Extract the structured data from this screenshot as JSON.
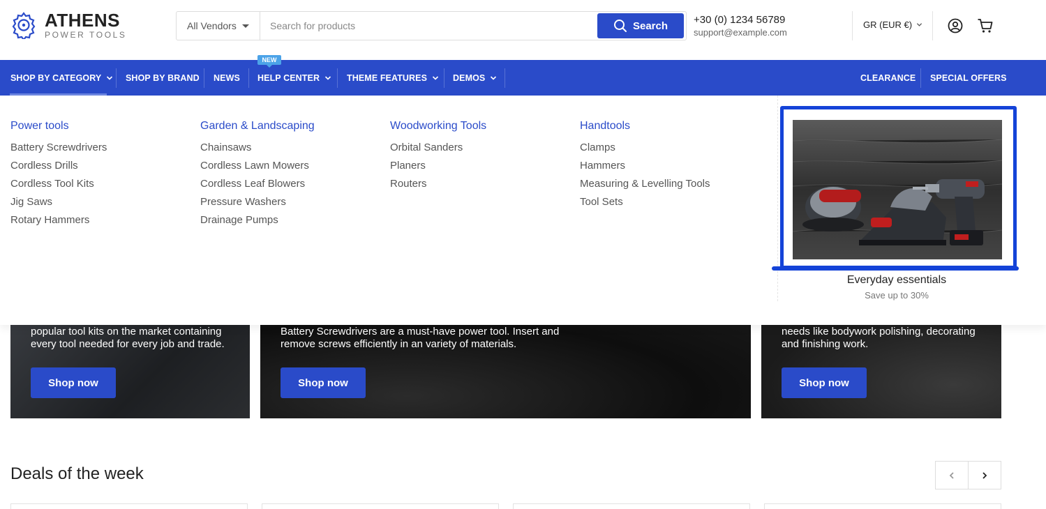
{
  "brand": {
    "name": "ATHENS",
    "tagline": "POWER TOOLS",
    "accent": "#2a4bc9"
  },
  "search": {
    "vendor_label": "All Vendors",
    "placeholder": "Search for products",
    "button_label": "Search"
  },
  "contact": {
    "phone": "+30 (0) 1234 56789",
    "email": "support@example.com"
  },
  "currency": {
    "label": "GR (EUR €)"
  },
  "header_icons": [
    "account-icon",
    "cart-icon"
  ],
  "nav": {
    "left": [
      {
        "label": "SHOP BY CATEGORY",
        "dropdown": true,
        "active": true
      },
      {
        "label": "SHOP BY BRAND",
        "dropdown": false
      },
      {
        "label": "NEWS",
        "dropdown": false
      },
      {
        "label": "HELP CENTER",
        "dropdown": true,
        "badge": "NEW"
      },
      {
        "label": "THEME FEATURES",
        "dropdown": true
      },
      {
        "label": "DEMOS",
        "dropdown": true
      }
    ],
    "right": [
      {
        "label": "CLEARANCE"
      },
      {
        "label": "SPECIAL OFFERS"
      }
    ]
  },
  "mega_menu": {
    "columns": [
      {
        "title": "Power tools",
        "items": [
          "Battery Screwdrivers",
          "Cordless Drills",
          "Cordless Tool Kits",
          "Jig Saws",
          "Rotary Hammers"
        ]
      },
      {
        "title": "Garden & Landscaping",
        "items": [
          "Chainsaws",
          "Cordless Lawn Mowers",
          "Cordless Leaf Blowers",
          "Pressure Washers",
          "Drainage Pumps"
        ]
      },
      {
        "title": "Woodworking Tools",
        "items": [
          "Orbital Sanders",
          "Planers",
          "Routers"
        ]
      },
      {
        "title": "Handtools",
        "items": [
          "Clamps",
          "Hammers",
          "Measuring & Levelling Tools",
          "Tool Sets"
        ]
      }
    ],
    "feature": {
      "title": "Everyday essentials",
      "subtitle": "Save up to 30%"
    }
  },
  "promos": [
    {
      "text": "popular tool kits on the market containing every tool needed for every job and trade.",
      "button": "Shop now"
    },
    {
      "text": "Battery Screwdrivers are a must-have power tool. Insert and remove screws efficiently in an variety of materials.",
      "button": "Shop now"
    },
    {
      "text": "needs like bodywork polishing, decorating and finishing work.",
      "button": "Shop now"
    }
  ],
  "deals": {
    "title": "Deals of the week"
  }
}
